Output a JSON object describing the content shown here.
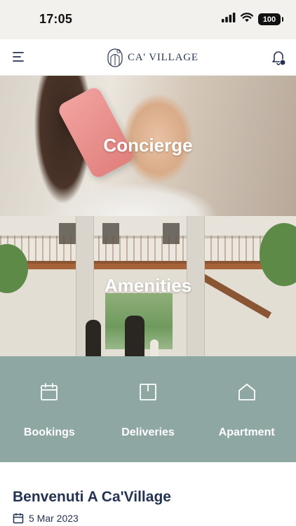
{
  "status_bar": {
    "time": "17:05",
    "battery": "100",
    "icons": [
      "signal-icon",
      "wifi-icon",
      "battery-icon"
    ]
  },
  "header": {
    "logo_text": "CA' VILLAGE",
    "icons": [
      "menu-icon",
      "logo-icon",
      "bell-icon"
    ],
    "notification_dot_color": "#253352"
  },
  "tiles": [
    {
      "label": "Concierge"
    },
    {
      "label": "Amenities"
    }
  ],
  "quick_actions": {
    "background_color": "#8ea7a3",
    "items": [
      {
        "label": "Bookings",
        "icon": "calendar-icon"
      },
      {
        "label": "Deliveries",
        "icon": "package-icon"
      },
      {
        "label": "Apartment",
        "icon": "home-icon"
      }
    ]
  },
  "welcome": {
    "title": "Benvenuti A Ca'Village",
    "date": "5 Mar 2023",
    "date_icon": "calendar-icon"
  },
  "colors": {
    "brand_navy": "#253352",
    "status_bar_bg": "#f2f1ee"
  }
}
